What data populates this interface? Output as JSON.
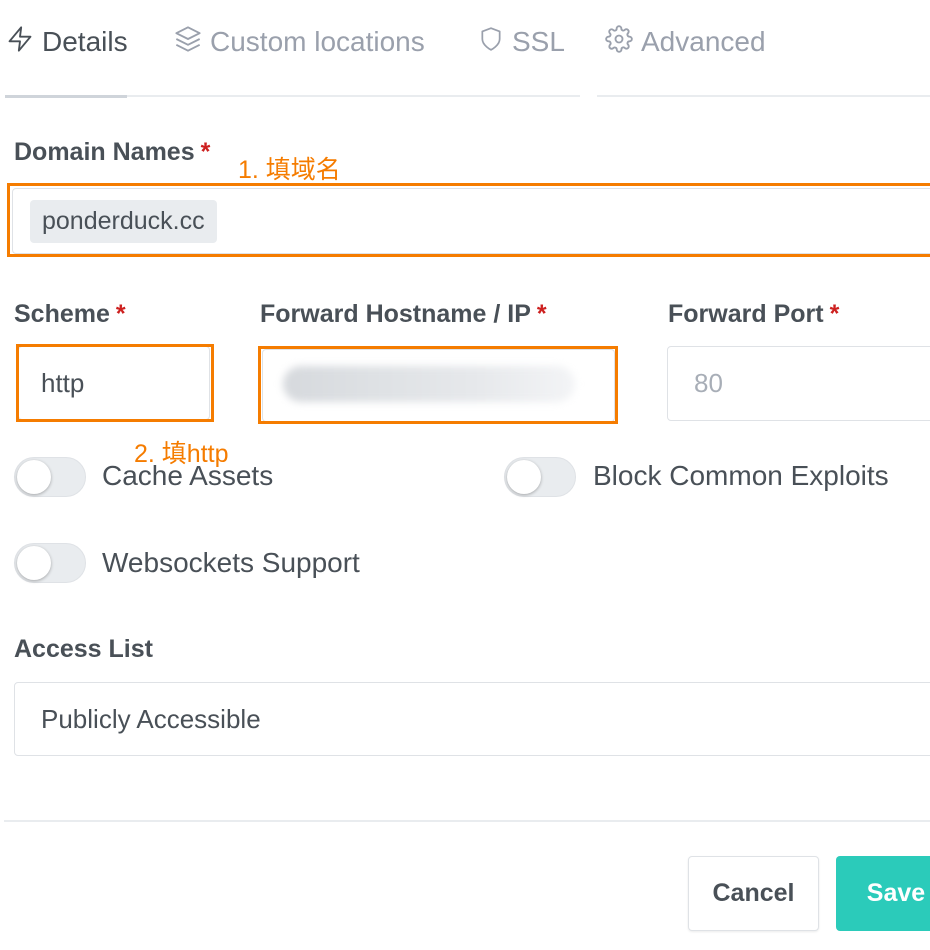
{
  "tabs": [
    {
      "label": "Details",
      "icon": "lightning-icon",
      "active": true
    },
    {
      "label": "Custom locations",
      "icon": "layers-icon",
      "active": false
    },
    {
      "label": "SSL",
      "icon": "shield-icon",
      "active": false
    },
    {
      "label": "Advanced",
      "icon": "gear-icon",
      "active": false
    }
  ],
  "form": {
    "domain_names": {
      "label": "Domain Names",
      "required_mark": "*",
      "value": "ponderduck.cc"
    },
    "scheme": {
      "label": "Scheme",
      "required_mark": "*",
      "value": "http"
    },
    "forward_host": {
      "label": "Forward Hostname / IP",
      "required_mark": "*",
      "value": ""
    },
    "forward_port": {
      "label": "Forward Port",
      "required_mark": "*",
      "placeholder": "80"
    },
    "toggles": {
      "cache_assets": {
        "label": "Cache Assets",
        "on": false
      },
      "block_exploits": {
        "label": "Block Common Exploits",
        "on": false
      },
      "websockets": {
        "label": "Websockets Support",
        "on": false
      }
    },
    "access_list": {
      "label": "Access List",
      "value": "Publicly Accessible"
    }
  },
  "annotations": {
    "step1": "1. 填域名",
    "step2": "2. 填http",
    "color": "#f57c00"
  },
  "buttons": {
    "cancel": "Cancel",
    "save": "Save"
  },
  "colors": {
    "accent": "#2bcbba",
    "required": "#cd201f"
  }
}
